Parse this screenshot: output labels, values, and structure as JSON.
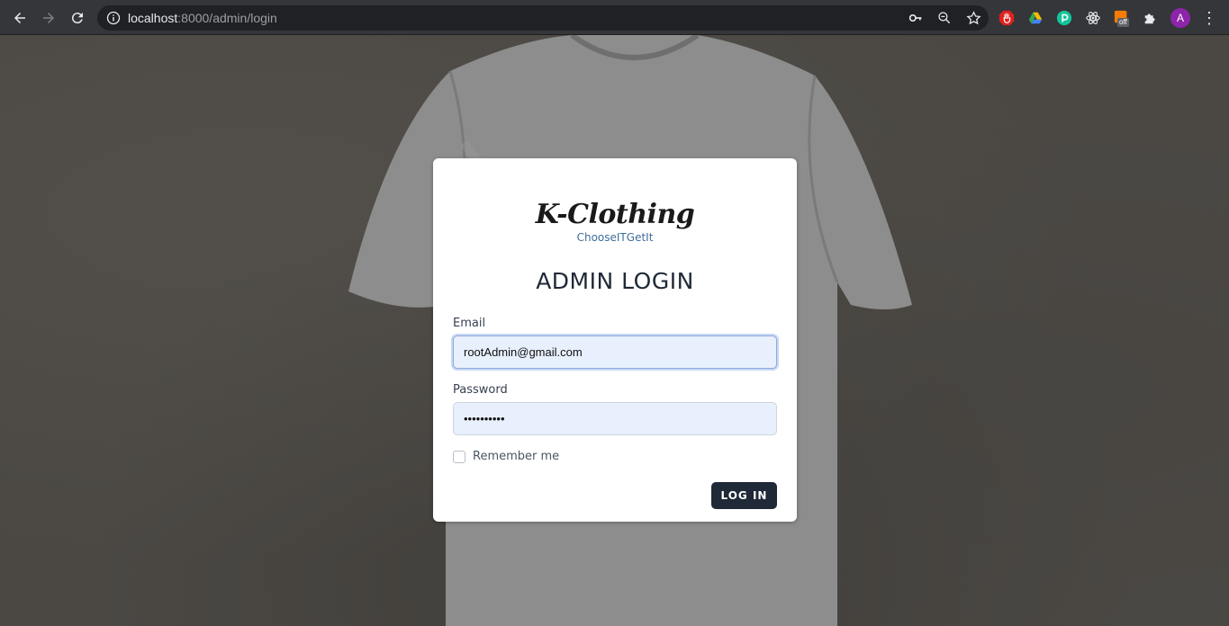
{
  "browser": {
    "url_host": "localhost",
    "url_path": ":8000/admin/login",
    "avatar_letter": "A",
    "ext_badge": "off"
  },
  "login": {
    "logo_text": "K-Clothing",
    "logo_tagline": "ChooseITGetIt",
    "title": "ADMIN LOGIN",
    "email_label": "Email",
    "email_value": "rootAdmin@gmail.com",
    "password_label": "Password",
    "password_value": "••••••••••",
    "remember_label": "Remember me",
    "login_button": "LOG IN"
  },
  "colors": {
    "button_bg": "#1f2937",
    "input_bg": "#e8f0fe",
    "tagline": "#3f6f9c"
  }
}
